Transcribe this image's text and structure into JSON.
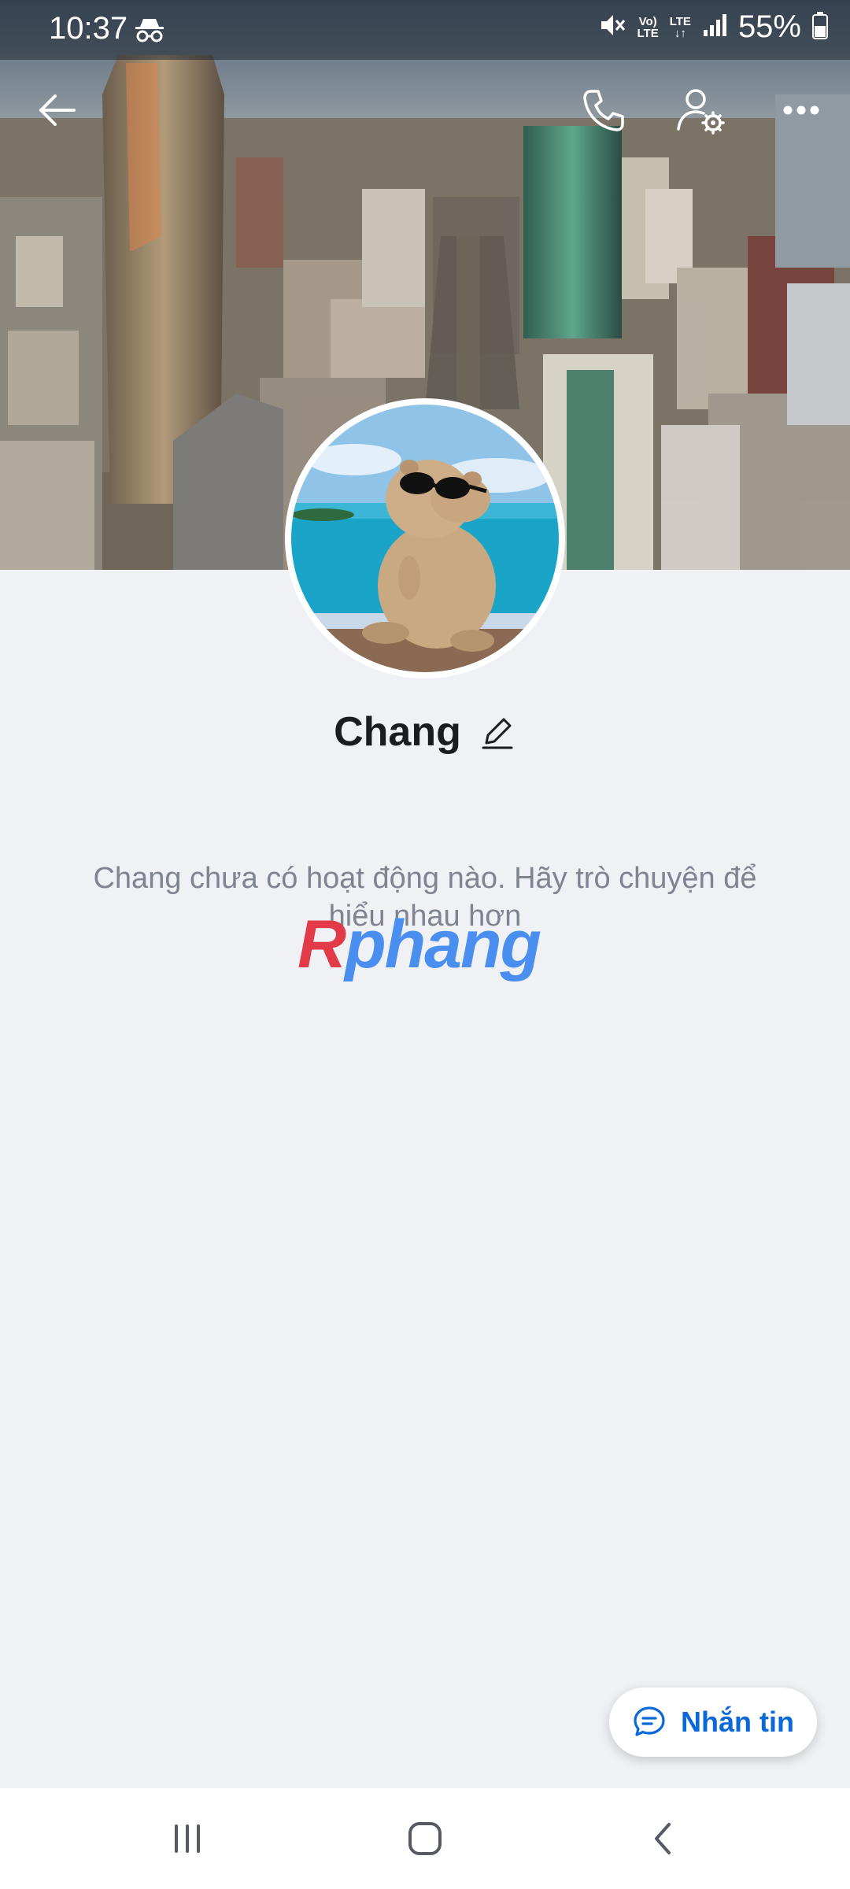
{
  "status_bar": {
    "time": "10:37",
    "battery": "55%",
    "network_top": "Vo)",
    "network_bottom": "LTE",
    "data_top": "LTE",
    "data_bottom": "↓↑",
    "icons": [
      "incognito-icon",
      "mute-icon",
      "volte-icon",
      "lte-icon",
      "signal-icon",
      "battery-icon"
    ]
  },
  "header": {
    "icons": [
      "back-arrow-icon",
      "phone-icon",
      "profile-settings-icon",
      "more-icon"
    ]
  },
  "profile": {
    "name": "Chang",
    "edit_icon": "pencil-icon"
  },
  "empty_state": {
    "line1": "Chang chưa có hoạt động nào. Hãy trò chuyện để",
    "line2": "hiểu nhau hơn"
  },
  "watermark": {
    "part1": "R",
    "part2": "phang"
  },
  "message_button": {
    "label": "Nhắn tin",
    "icon": "chat-bubble-icon"
  },
  "nav_bar": {
    "icons": [
      "recent-apps-icon",
      "home-icon",
      "back-icon"
    ]
  },
  "colors": {
    "background": "#eff1f5",
    "accent": "#0a68d8",
    "text_primary": "#1a1c22",
    "text_secondary": "#7f8490"
  }
}
